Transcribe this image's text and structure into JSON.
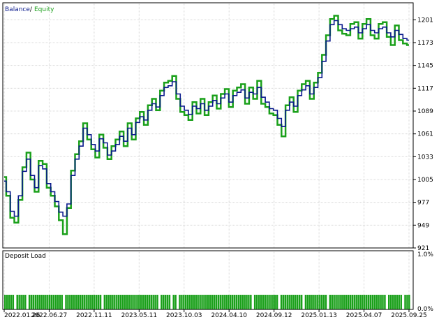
{
  "legend": {
    "balance_label": "Balance",
    "separator": " / ",
    "equity_label": "Equity"
  },
  "deposit_panel": {
    "title": "Deposit Load",
    "y_top_label": "1.0%",
    "y_bottom_label": "0.0%"
  },
  "colors": {
    "balance": "#0a1a8c",
    "equity": "#1aa01a",
    "grid": "#d8d8d8",
    "frame": "#000000",
    "text": "#000000",
    "deposit_bar": "#1aa01a"
  },
  "chart_data": {
    "type": "line",
    "ylim": [
      921,
      1215
    ],
    "y_ticks": [
      921,
      949,
      977,
      1005,
      1033,
      1061,
      1089,
      1117,
      1145,
      1173,
      1201
    ],
    "x_tick_labels": [
      "2022.01.26",
      "2022.06.27",
      "2022.11.11",
      "2023.05.11",
      "2023.10.03",
      "2024.04.10",
      "2024.09.12",
      "2025.01.13",
      "2025.04.07",
      "2025.09.25"
    ],
    "grid": true,
    "legend_position": "top-left",
    "series": [
      {
        "name": "Balance",
        "x_fraction": [
          0,
          0.01,
          0.02,
          0.03,
          0.04,
          0.05,
          0.06,
          0.07,
          0.08,
          0.09,
          0.1,
          0.11,
          0.12,
          0.13,
          0.14,
          0.15,
          0.16,
          0.17,
          0.18,
          0.19,
          0.2,
          0.21,
          0.22,
          0.23,
          0.24,
          0.25,
          0.26,
          0.27,
          0.28,
          0.29,
          0.3,
          0.31,
          0.32,
          0.33,
          0.34,
          0.35,
          0.36,
          0.37,
          0.38,
          0.39,
          0.4,
          0.41,
          0.42,
          0.43,
          0.44,
          0.45,
          0.46,
          0.47,
          0.48,
          0.49,
          0.5,
          0.51,
          0.52,
          0.53,
          0.54,
          0.55,
          0.56,
          0.57,
          0.58,
          0.59,
          0.6,
          0.61,
          0.62,
          0.63,
          0.64,
          0.65,
          0.66,
          0.67,
          0.68,
          0.69,
          0.7,
          0.71,
          0.72,
          0.73,
          0.74,
          0.75,
          0.76,
          0.77,
          0.78,
          0.79,
          0.8,
          0.81,
          0.82,
          0.83,
          0.84,
          0.85,
          0.86,
          0.87,
          0.88,
          0.89,
          0.9,
          0.91,
          0.92,
          0.93,
          0.94,
          0.95,
          0.96,
          0.97,
          0.98,
          0.99,
          1.0
        ],
        "values": [
          1003,
          990,
          966,
          960,
          985,
          1015,
          1030,
          1010,
          995,
          1022,
          1018,
          1000,
          990,
          978,
          965,
          960,
          975,
          1010,
          1030,
          1046,
          1068,
          1060,
          1048,
          1040,
          1055,
          1050,
          1035,
          1040,
          1048,
          1058,
          1052,
          1068,
          1060,
          1075,
          1082,
          1078,
          1090,
          1098,
          1094,
          1108,
          1118,
          1120,
          1125,
          1110,
          1095,
          1090,
          1085,
          1095,
          1092,
          1098,
          1090,
          1095,
          1102,
          1098,
          1105,
          1110,
          1100,
          1108,
          1112,
          1115,
          1105,
          1112,
          1110,
          1118,
          1106,
          1100,
          1092,
          1090,
          1080,
          1070,
          1090,
          1100,
          1095,
          1108,
          1115,
          1120,
          1110,
          1118,
          1130,
          1150,
          1175,
          1195,
          1200,
          1195,
          1190,
          1188,
          1190,
          1192,
          1185,
          1190,
          1195,
          1188,
          1185,
          1190,
          1192,
          1185,
          1180,
          1188,
          1183,
          1178,
          1176
        ]
      },
      {
        "name": "Equity",
        "x_fraction": [
          0,
          0.01,
          0.02,
          0.03,
          0.04,
          0.05,
          0.06,
          0.07,
          0.08,
          0.09,
          0.1,
          0.11,
          0.12,
          0.13,
          0.14,
          0.15,
          0.16,
          0.17,
          0.18,
          0.19,
          0.2,
          0.21,
          0.22,
          0.23,
          0.24,
          0.25,
          0.26,
          0.27,
          0.28,
          0.29,
          0.3,
          0.31,
          0.32,
          0.33,
          0.34,
          0.35,
          0.36,
          0.37,
          0.38,
          0.39,
          0.4,
          0.41,
          0.42,
          0.43,
          0.44,
          0.45,
          0.46,
          0.47,
          0.48,
          0.49,
          0.5,
          0.51,
          0.52,
          0.53,
          0.54,
          0.55,
          0.56,
          0.57,
          0.58,
          0.59,
          0.6,
          0.61,
          0.62,
          0.63,
          0.64,
          0.65,
          0.66,
          0.67,
          0.68,
          0.69,
          0.7,
          0.71,
          0.72,
          0.73,
          0.74,
          0.75,
          0.76,
          0.77,
          0.78,
          0.79,
          0.8,
          0.81,
          0.82,
          0.83,
          0.84,
          0.85,
          0.86,
          0.87,
          0.88,
          0.89,
          0.9,
          0.91,
          0.92,
          0.93,
          0.94,
          0.95,
          0.96,
          0.97,
          0.98,
          0.99,
          1.0
        ],
        "values": [
          1008,
          985,
          958,
          952,
          980,
          1020,
          1038,
          1005,
          990,
          1028,
          1024,
          995,
          985,
          972,
          955,
          938,
          970,
          1016,
          1036,
          1052,
          1074,
          1054,
          1042,
          1032,
          1060,
          1044,
          1030,
          1046,
          1054,
          1064,
          1046,
          1074,
          1054,
          1080,
          1088,
          1072,
          1096,
          1104,
          1090,
          1114,
          1124,
          1126,
          1132,
          1104,
          1088,
          1084,
          1078,
          1100,
          1086,
          1104,
          1084,
          1100,
          1108,
          1092,
          1110,
          1116,
          1094,
          1114,
          1118,
          1122,
          1098,
          1118,
          1104,
          1126,
          1098,
          1094,
          1086,
          1084,
          1072,
          1058,
          1096,
          1106,
          1088,
          1114,
          1122,
          1126,
          1104,
          1124,
          1136,
          1158,
          1182,
          1202,
          1206,
          1188,
          1184,
          1182,
          1196,
          1198,
          1178,
          1196,
          1202,
          1182,
          1178,
          1196,
          1198,
          1180,
          1170,
          1194,
          1176,
          1172,
          1170
        ]
      }
    ],
    "deposit_load": {
      "ylim": [
        0,
        1.0
      ],
      "bar_count": 200,
      "typical_value_pct": 0.25
    }
  }
}
